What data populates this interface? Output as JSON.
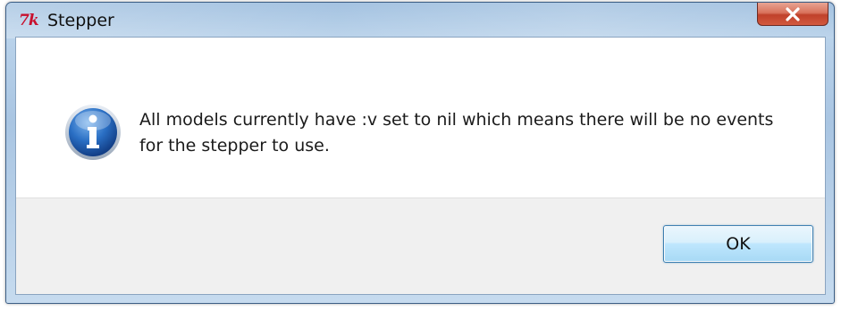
{
  "window": {
    "title": "Stepper",
    "app_icon": "tk-feather-icon",
    "close_icon": "close-icon"
  },
  "dialog": {
    "icon": "info-icon",
    "message": "All models currently have :v set to nil which means there will be no events for the stepper to use.",
    "ok_label": "OK"
  },
  "colors": {
    "close_button": "#c9462d",
    "ok_border": "#3c7fb1",
    "info_blue": "#1d5fb0"
  }
}
